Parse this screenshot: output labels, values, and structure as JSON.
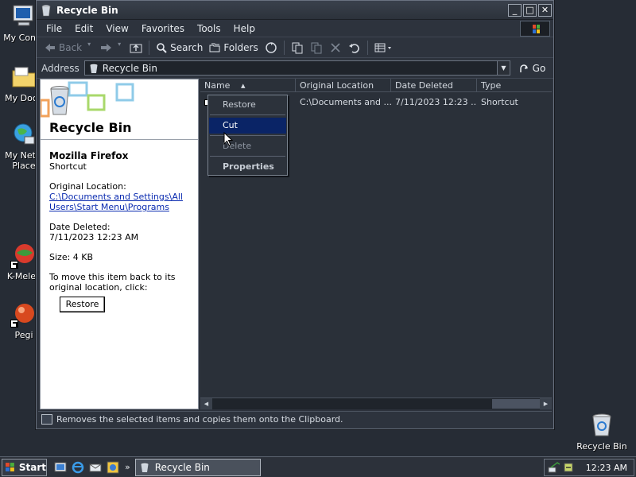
{
  "desktop": {
    "icons": [
      {
        "label": "My Comp"
      },
      {
        "label": "My Docu"
      },
      {
        "label": "My Netw\nPlace"
      },
      {
        "label": "K-Melec"
      },
      {
        "label": "Pegi"
      },
      {
        "label": "Recycle Bin"
      }
    ]
  },
  "window": {
    "title": "Recycle Bin",
    "menu": [
      "File",
      "Edit",
      "View",
      "Favorites",
      "Tools",
      "Help"
    ],
    "toolbar": {
      "back": "Back",
      "search": "Search",
      "folders": "Folders"
    },
    "address": {
      "label": "Address",
      "value": "Recycle Bin",
      "go": "Go"
    }
  },
  "taskpane": {
    "title": "Recycle Bin",
    "item_name": "Mozilla Firefox",
    "item_type": "Shortcut",
    "original_location_label": "Original Location:",
    "original_location_value": "C:\\Documents and Settings\\All Users\\Start Menu\\Programs",
    "date_deleted_label": "Date Deleted:",
    "date_deleted_value": "7/11/2023 12:23 AM",
    "size": "Size: 4 KB",
    "restore_hint": "To move this item back to its original location, click:",
    "restore_button": "Restore"
  },
  "filelist": {
    "columns": [
      "Name",
      "Original Location",
      "Date Deleted",
      "Type"
    ],
    "rows": [
      {
        "name": "",
        "location": "C:\\Documents and ...",
        "deleted": "7/11/2023 12:23 ...",
        "type": "Shortcut"
      }
    ]
  },
  "context_menu": {
    "items": [
      "Restore",
      "Cut",
      "Delete",
      "Properties"
    ],
    "highlighted": "Cut"
  },
  "statusbar": {
    "text": "Removes the selected items and copies them onto the Clipboard."
  },
  "taskbar": {
    "start": "Start",
    "more": "»",
    "task_label": "Recycle Bin",
    "clock": "12:23 AM"
  },
  "colors": {
    "desktop_bg": "#262c35",
    "window_bg": "#2d333d",
    "menu_highlight": "#0a2466",
    "link": "#0a2bb0"
  }
}
